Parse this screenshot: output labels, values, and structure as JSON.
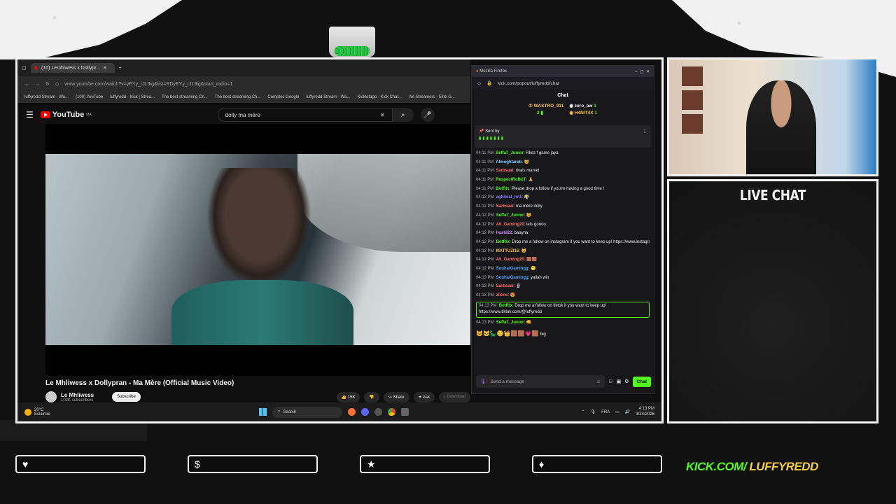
{
  "browser": {
    "tab_title": "(10) Lemhlwess x Dollypr...",
    "url": "www.youtube.com/watch?v=yEYy_rJL9ig&list=RDyEYy_rJL9ig&start_radio=1",
    "bookmarks": [
      "luffyredd Stream - Wa...",
      "(100) YouTube",
      "luffyredd - Kick | Strea...",
      "The best streaming Ch...",
      "The best streaming Ch...",
      "Comptes Google",
      "luffyredd Stream - Wa...",
      "Kickletapp - Kick Chat...",
      "AK Streamers - Elite G..."
    ]
  },
  "youtube": {
    "logo": "YouTube",
    "region": "MA",
    "search_value": "dolly ma mère",
    "video_title": "Le Mhliwess x Dollypran - Ma Mère (Official Music Video)",
    "channel_name": "Le Mhliwess",
    "subscribers": "102K subscribers",
    "subscribe_label": "Subscribe",
    "likes": "15K",
    "share_label": "Share",
    "ask_label": "Ask",
    "download_label": "Download"
  },
  "kick": {
    "window_title": "Mozilla Firefox",
    "url": "kick.com/popout/luffyredd/chat",
    "panel_title": "Chat",
    "leaders": [
      {
        "name": "WASTRO_911",
        "count": "2"
      },
      {
        "name": "zero_aw",
        "count": "1"
      },
      {
        "name": "H4NIT4X",
        "count": "1"
      }
    ],
    "pinned_label": "Sent by",
    "messages": [
      {
        "time": "04:11 PM",
        "user": "Seffa7_Junior",
        "color": "#53fc18",
        "text": ": Rkez f game jaya"
      },
      {
        "time": "04:11 PM",
        "user": "Almoghtareb",
        "color": "#7ad0ff",
        "text": ": 😺"
      },
      {
        "time": "04:11 PM",
        "user": "Sarbsaai",
        "color": "#ff6b6b",
        "text": ": rivals marvel"
      },
      {
        "time": "04:11 PM",
        "user": "RespectRoBoT",
        "color": "#53fc18",
        "text": ": 🙏"
      },
      {
        "time": "04:11 PM",
        "user": "BotRix",
        "color": "#53fc18",
        "text": ": Please drop a follow if you're having a good time !"
      },
      {
        "time": "04:12 PM",
        "user": "aghiteal_nn1",
        "color": "#8a7bff",
        "text": ": 😶‍🌫️"
      },
      {
        "time": "04:12 PM",
        "user": "Sarbsaai",
        "color": "#ff6b6b",
        "text": ": ma mère dolly"
      },
      {
        "time": "04:12 PM",
        "user": "Seffa7_Junior",
        "color": "#53fc18",
        "text": ": 😺"
      },
      {
        "time": "04:12 PM",
        "user": "Ali_Gaming20",
        "color": "#ff6b6b",
        "text": ": lets goooo"
      },
      {
        "time": "04:12 PM",
        "user": "hushi22",
        "color": "#d58cff",
        "text": ": baayna"
      },
      {
        "time": "04:12 PM",
        "user": "BotRix",
        "color": "#53fc18",
        "text": ": Drop me a follow on instagram if you want to keep up! https://www.instagram.com/luffyredd/"
      },
      {
        "time": "04:12 PM",
        "user": "MATTUZI15",
        "color": "#f5c542",
        "text": ": 😺"
      },
      {
        "time": "04:12 PM",
        "user": "Ali_Gaming20",
        "color": "#ff6b6b",
        "text": ": 🟫🟫"
      },
      {
        "time": "04:12 PM",
        "user": "SouhaiGamingg",
        "color": "#4fa3ff",
        "text": ": 😶"
      },
      {
        "time": "04:13 PM",
        "user": "SouhaiGamingg",
        "color": "#4fa3ff",
        "text": ": yallah win"
      },
      {
        "time": "04:13 PM",
        "user": "Sarbsaai",
        "color": "#ff6b6b",
        "text": ": 🗿"
      },
      {
        "time": "04:13 PM",
        "user": "ziicnc",
        "color": "#ff6b6b",
        "text": ": 😍"
      },
      {
        "time": "04:13 PM",
        "user": "BotRix",
        "color": "#53fc18",
        "text": ": Drop me a follow on tiktok if you want to keep up! https://www.tiktok.com/@luffyredd"
      },
      {
        "time": "04:13 PM",
        "user": "Seffa7_Junior",
        "color": "#53fc18",
        "text": ": 👊"
      }
    ],
    "emote_tail": "big",
    "input_placeholder": "Send a message",
    "chat_button": "Chat"
  },
  "taskbar": {
    "temp": "20°C",
    "weather": "Éclaircie",
    "search_label": "Search",
    "lang": "FRA",
    "time": "4:13 PM",
    "date": "3/24/2026"
  },
  "overlay": {
    "live_chat_title": "LIVE CHAT",
    "boxes": [
      {
        "icon": "♥"
      },
      {
        "icon": "$"
      },
      {
        "icon": "★"
      },
      {
        "icon": "♦"
      }
    ],
    "brand_kick": "KICK.COM/",
    "brand_user": "LUFFYREDD"
  }
}
